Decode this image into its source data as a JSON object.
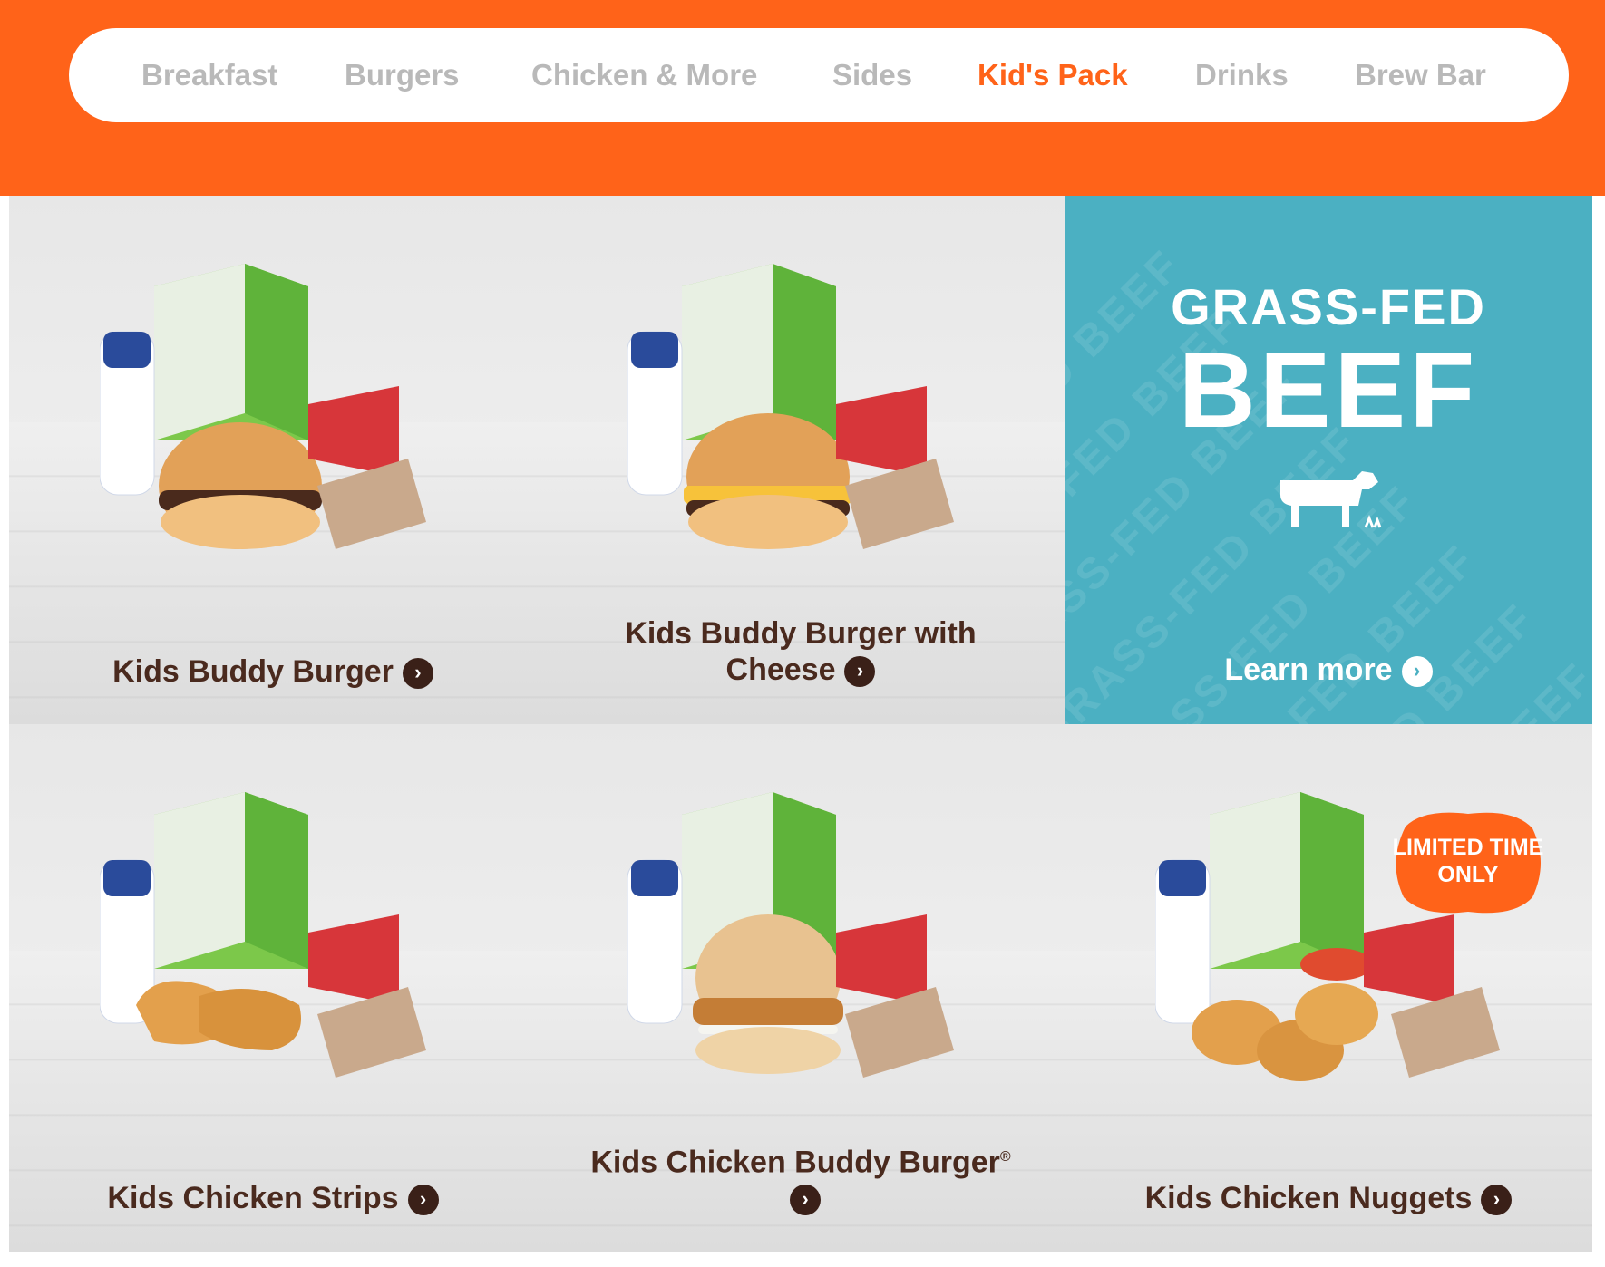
{
  "nav": {
    "items": [
      {
        "label": "Breakfast"
      },
      {
        "label": "Burgers"
      },
      {
        "label": "Chicken & More"
      },
      {
        "label": "Sides"
      },
      {
        "label": "Kid's Pack"
      },
      {
        "label": "Drinks"
      },
      {
        "label": "Brew Bar"
      }
    ],
    "active": "Kid's Pack"
  },
  "tiles": [
    {
      "label": "Kids Buddy Burger",
      "image": "kids-pack-buddy-burger"
    },
    {
      "label": "Kids Buddy Burger with Cheese",
      "image": "kids-pack-buddy-burger-cheese"
    },
    {
      "label": "Kids Chicken Strips",
      "image": "kids-pack-chicken-strips"
    },
    {
      "label": "Kids Chicken Buddy Burger",
      "label_mark": "®",
      "image": "kids-pack-chicken-buddy-burger"
    },
    {
      "label": "Kids Chicken Nuggets",
      "image": "kids-pack-chicken-nuggets",
      "badge": "LIMITED TIME ONLY"
    }
  ],
  "promo": {
    "subtitle": "GRASS-FED",
    "title": "BEEF",
    "link_label": "Learn more",
    "watermark": "GRASS-FED BEEF",
    "background_color": "#4bb0c2"
  },
  "colors": {
    "brand_orange": "#ff6319",
    "label_brown": "#4a2a1e",
    "inactive_nav": "#b9b9b9"
  },
  "icons": [
    "chevron-right-icon",
    "cow-icon",
    "badge-icon"
  ]
}
